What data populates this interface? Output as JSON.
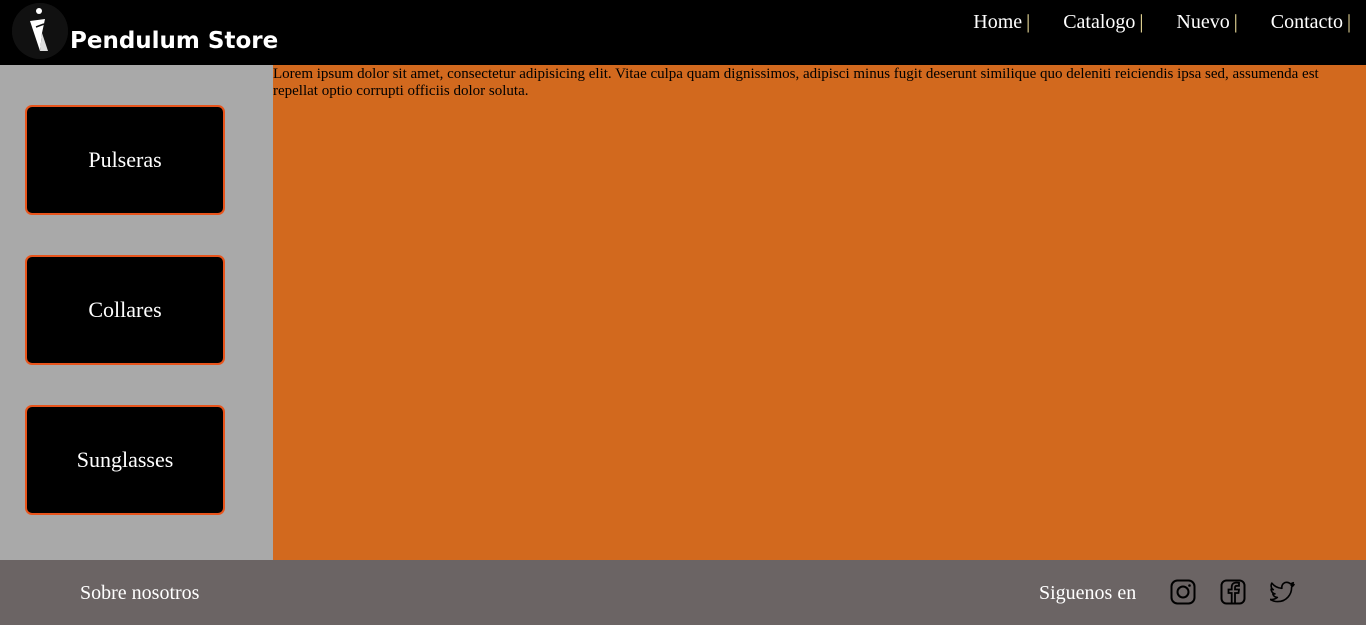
{
  "header": {
    "brand": "Pendulum Store",
    "logo_icon": "pendulum-logo-icon",
    "nav": [
      {
        "label": "Home",
        "sep": "|"
      },
      {
        "label": "Catalogo",
        "sep": "|"
      },
      {
        "label": "Nuevo",
        "sep": "|"
      },
      {
        "label": "Contacto",
        "sep": "|"
      }
    ]
  },
  "sidebar": {
    "categories": [
      {
        "label": "Pulseras"
      },
      {
        "label": "Collares"
      },
      {
        "label": "Sunglasses"
      }
    ]
  },
  "main": {
    "text": "Lorem ipsum dolor sit amet, consectetur adipisicing elit. Vitae culpa quam dignissimos, adipisci minus fugit deserunt similique quo deleniti reiciendis ipsa sed, assumenda est repellat optio corrupti officiis dolor soluta."
  },
  "footer": {
    "about": "Sobre nosotros",
    "follow": "Siguenos en",
    "social": [
      "instagram-icon",
      "facebook-icon",
      "twitter-icon"
    ]
  },
  "colors": {
    "header_bg": "#000000",
    "sidebar_bg": "#a9a9a9",
    "main_bg": "#d2691e",
    "footer_bg": "#6b6464",
    "button_border": "#e8541c",
    "nav_separator": "#f4e4a0"
  }
}
